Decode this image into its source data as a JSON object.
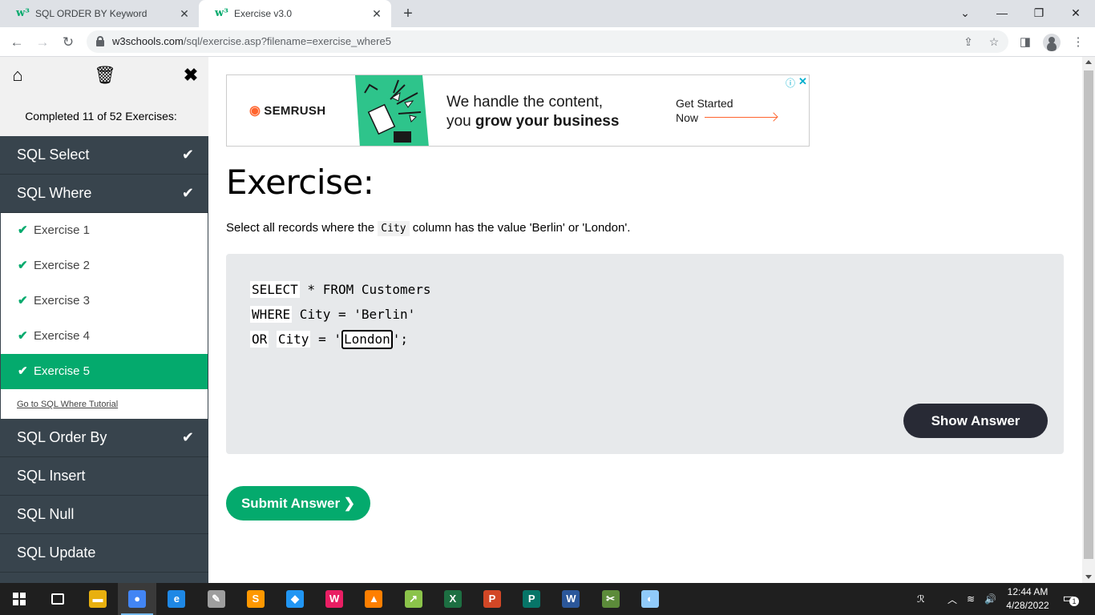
{
  "browser": {
    "tabs": [
      {
        "title": "SQL ORDER BY Keyword",
        "favicon": "w3schools-icon",
        "active": false
      },
      {
        "title": "Exercise v3.0",
        "favicon": "w3schools-icon",
        "active": true
      }
    ],
    "favicon_glyph": "w³",
    "url_host": "w3schools.com",
    "url_path": "/sql/exercise.asp?filename=exercise_where5"
  },
  "sidebar": {
    "completed_text": "Completed 11 of 52 Exercises:",
    "items": [
      {
        "label": "SQL Select",
        "completed": true
      },
      {
        "label": "SQL Where",
        "completed": true,
        "expanded": true
      },
      {
        "label": "SQL Order By",
        "completed": true
      },
      {
        "label": "SQL Insert",
        "completed": false
      },
      {
        "label": "SQL Null",
        "completed": false
      },
      {
        "label": "SQL Update",
        "completed": false
      }
    ],
    "sub_items": [
      {
        "label": "Exercise 1",
        "active": false
      },
      {
        "label": "Exercise 2",
        "active": false
      },
      {
        "label": "Exercise 3",
        "active": false
      },
      {
        "label": "Exercise 4",
        "active": false
      },
      {
        "label": "Exercise 5",
        "active": true
      }
    ],
    "tutorial_link": "Go to SQL Where Tutorial",
    "colors": {
      "menu_bg": "#38444d",
      "active_green": "#04aa6d"
    }
  },
  "ad": {
    "brand": "SEMRUSH",
    "headline_line1": "We handle the content,",
    "headline_line2_plain": "you ",
    "headline_line2_bold": "grow your business",
    "cta_line1": "Get Started",
    "cta_line2": "Now",
    "info_icon": "ⓘ",
    "close_icon": "✕",
    "colors": {
      "brand_orange": "#ff642d",
      "art_green": "#2ec48b"
    }
  },
  "exercise": {
    "title": "Exercise:",
    "desc_before": "Select all records where the ",
    "desc_code": "City",
    "desc_after": " column has the value 'Berlin' or 'London'.",
    "code": {
      "l1_kw": "SELECT",
      "l1_rest": " * FROM Customers",
      "l2_kw": "WHERE",
      "l2_rest": " City = 'Berlin'",
      "l3_kw": "OR",
      "l3_mid_kw": "City",
      "l3_eq": " = '",
      "answer_value": "London",
      "l3_end": "';"
    },
    "show_answer_label": "Show Answer",
    "submit_label": "Submit Answer ❯"
  },
  "taskbar": {
    "apps": [
      {
        "name": "file-explorer-icon",
        "glyph": "▬",
        "color": "#e8b00f"
      },
      {
        "name": "chrome-icon",
        "glyph": "●",
        "color": "#4285f4",
        "active": true
      },
      {
        "name": "edge-icon",
        "glyph": "e",
        "color": "#1e88e5"
      },
      {
        "name": "text-editor-icon",
        "glyph": "✎",
        "color": "#9e9e9e"
      },
      {
        "name": "sublime-icon",
        "glyph": "S",
        "color": "#ff9800"
      },
      {
        "name": "fluent-icon",
        "glyph": "◆",
        "color": "#2196f3"
      },
      {
        "name": "wamp-icon",
        "glyph": "W",
        "color": "#e91e63"
      },
      {
        "name": "vlc-icon",
        "glyph": "▲",
        "color": "#ff7f00"
      },
      {
        "name": "chart-app-icon",
        "glyph": "↗",
        "color": "#8bc34a"
      },
      {
        "name": "excel-icon",
        "glyph": "X",
        "color": "#1d6f42"
      },
      {
        "name": "powerpoint-icon",
        "glyph": "P",
        "color": "#d24726"
      },
      {
        "name": "publisher-icon",
        "glyph": "P",
        "color": "#077568"
      },
      {
        "name": "word-icon",
        "glyph": "W",
        "color": "#2b579a"
      },
      {
        "name": "snipping-icon",
        "glyph": "✂",
        "color": "#5c8b3a"
      },
      {
        "name": "paint-icon",
        "glyph": "◐",
        "color": "#90caf9"
      }
    ],
    "time": "12:44 AM",
    "date": "4/28/2022",
    "notification_count": "1"
  }
}
